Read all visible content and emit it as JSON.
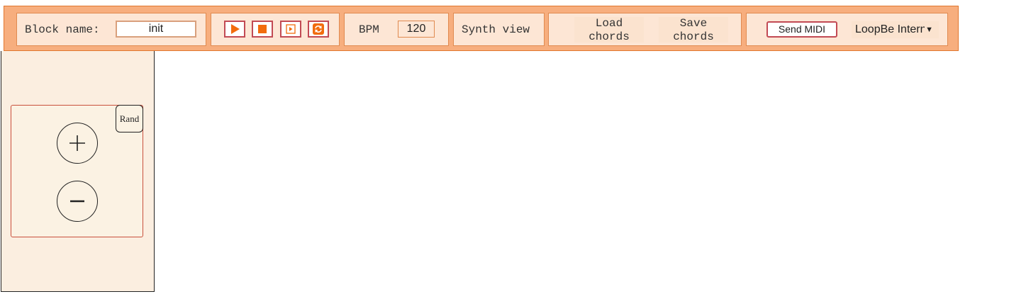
{
  "toolbar": {
    "block_name_label": "Block name:",
    "block_name_value": "init",
    "transport": {
      "play_icon": "play-icon",
      "stop_icon": "stop-icon",
      "step_icon": "step-icon",
      "loop_icon": "loop-icon"
    },
    "bpm_label": "BPM",
    "bpm_value": "120",
    "synth_view_label": "Synth view",
    "load_chords": [
      "Load",
      "chords"
    ],
    "save_chords": [
      "Save",
      "chords"
    ],
    "send_midi_label": "Send MIDI",
    "midi_device": "LoopBe Internal MIDI"
  },
  "sidebar": {
    "rand_label": "Rand",
    "add_icon": "plus-icon",
    "remove_icon": "minus-icon"
  },
  "colors": {
    "toolbar_bg": "#f7ae7e",
    "panel_bg": "#fde6d5",
    "accent_orange": "#f26c0d",
    "accent_red": "#c24a54",
    "sidebar_bg": "#fbeee0"
  }
}
